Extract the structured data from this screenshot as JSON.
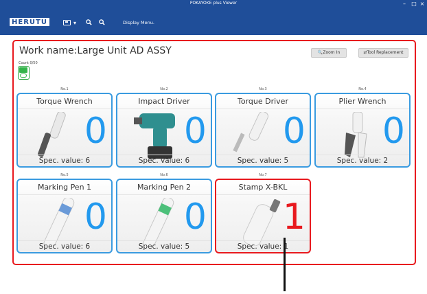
{
  "window": {
    "title": "POKAYOKE plus Viewer",
    "controls": {
      "minimize": "–",
      "maximize": "□",
      "close": "×"
    }
  },
  "toolbar": {
    "logo": "HERUTU",
    "screen_icon": "monitor-icon",
    "screen_caret": "▾",
    "zoom_in_icon": "zoom-in-icon",
    "zoom_out_icon": "zoom-out-icon",
    "display_menu": "Display Menu."
  },
  "main": {
    "work_title": "Work name:Large Unit AD ASSY",
    "count_label": "Count 0/50",
    "zoom_in_label": "🔍Zoom In",
    "tool_replacement_label": "⇄Tool Replacement"
  },
  "colors": {
    "title_bar": "#1f4e99",
    "frame_alert": "#e8191e",
    "card_border": "#3a9be0",
    "count_normal": "#2299ee",
    "count_alert": "#e8191e",
    "status_green": "#34b44a"
  },
  "tools": [
    {
      "no": "No.1",
      "name": "Torque Wrench",
      "count": "0",
      "spec": "Spec. value: 6",
      "alert": false,
      "icon": "torque-wrench"
    },
    {
      "no": "No.2",
      "name": "Impact Driver",
      "count": "0",
      "spec": "Spec. value: 6",
      "alert": false,
      "icon": "impact-driver"
    },
    {
      "no": "No.3",
      "name": "Torque Driver",
      "count": "0",
      "spec": "Spec. value: 5",
      "alert": false,
      "icon": "torque-driver"
    },
    {
      "no": "No.4",
      "name": "Plier Wrench",
      "count": "0",
      "spec": "Spec. value: 2",
      "alert": false,
      "icon": "plier-wrench"
    },
    {
      "no": "No.5",
      "name": "Marking Pen 1",
      "count": "0",
      "spec": "Spec. value: 6",
      "alert": false,
      "icon": "marking-pen"
    },
    {
      "no": "No.6",
      "name": "Marking Pen 2",
      "count": "0",
      "spec": "Spec. value: 5",
      "alert": false,
      "icon": "marking-pen"
    },
    {
      "no": "No.7",
      "name": "Stamp X-BKL",
      "count": "1",
      "spec": "Spec. value: 1",
      "alert": true,
      "icon": "stamp"
    }
  ]
}
